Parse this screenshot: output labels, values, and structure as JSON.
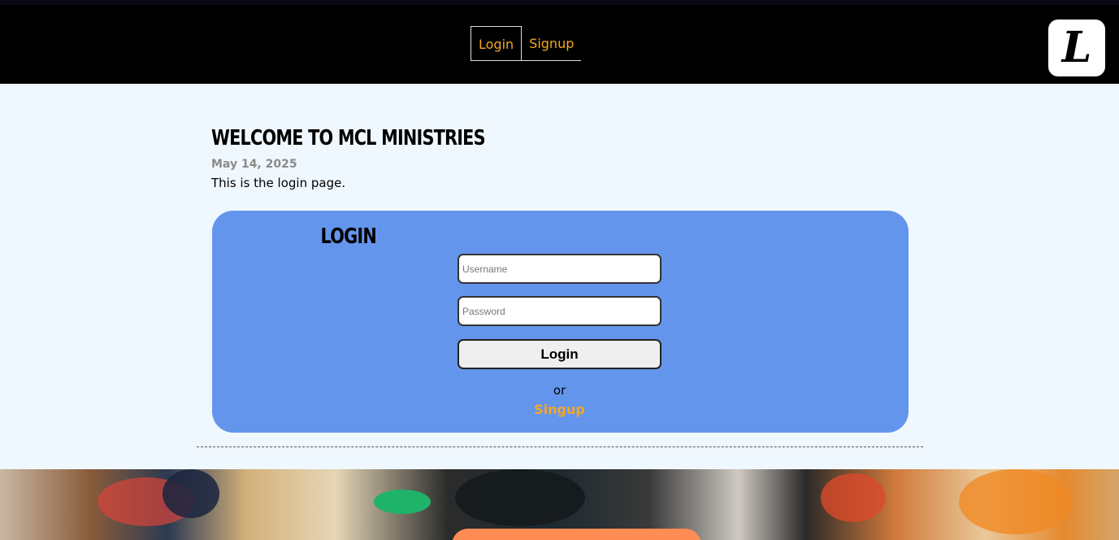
{
  "nav": {
    "tabs": [
      {
        "label": "Login",
        "active": true
      },
      {
        "label": "Signup",
        "active": false
      }
    ]
  },
  "logo": {
    "letter": "L"
  },
  "page": {
    "heading": "WELCOME TO MCL MINISTRIES",
    "date": "May 14, 2025",
    "description": "This is the login page."
  },
  "login_form": {
    "title": "LOGIN",
    "username_placeholder": "Username",
    "password_placeholder": "Password",
    "submit_label": "Login",
    "or_text": "or",
    "signup_link": "Singup"
  },
  "colors": {
    "accent": "#f5a623",
    "card": "#6495ed",
    "topbar": "#000000",
    "background": "#f0f8ff"
  }
}
